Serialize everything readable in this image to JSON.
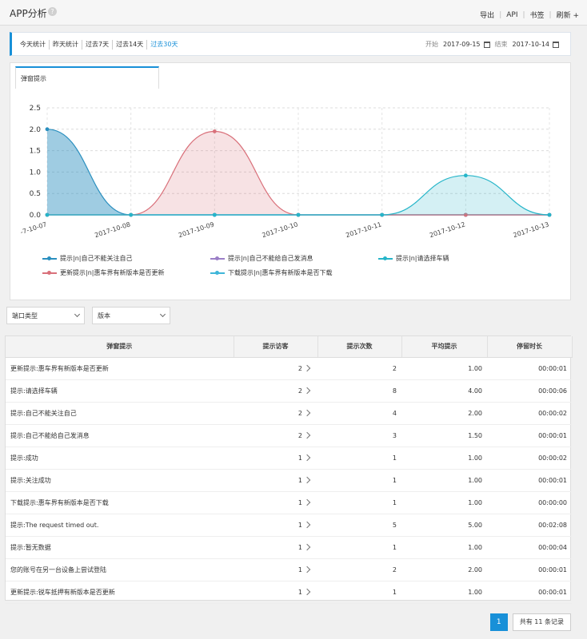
{
  "header": {
    "title": "APP分析",
    "help_icon": "help-icon",
    "actions": [
      "导出",
      "API",
      "书签",
      "刷新 +"
    ]
  },
  "period": {
    "tabs": [
      "今天统计",
      "昨天统计",
      "过去7天",
      "过去14天",
      "过去30天"
    ],
    "active": 4,
    "start_label": "开始",
    "start_value": "2017-09-15",
    "end_label": "结束",
    "end_value": "2017-10-14"
  },
  "chart": {
    "tab_label": "弹窗提示"
  },
  "chart_data": {
    "type": "area",
    "x": [
      "2017-10-07",
      "2017-10-08",
      "2017-10-09",
      "2017-10-10",
      "2017-10-11",
      "2017-10-12",
      "2017-10-13"
    ],
    "x_tick_labels": [
      "-7-10-07",
      "2017-10-08",
      "2017-10-09",
      "2017-10-10",
      "2017-10-11",
      "2017-10-12",
      "2017-10-13"
    ],
    "ylim": [
      0,
      2.5
    ],
    "y_ticks": [
      "0.0",
      "0.5",
      "1.0",
      "1.5",
      "2.0",
      "2.5"
    ],
    "grid": true,
    "legend_position": "bottom",
    "series": [
      {
        "name": "提示|n|自己不能关注自己",
        "color": "#2a8fbf",
        "values": [
          2,
          0,
          0,
          0,
          0,
          0,
          0
        ]
      },
      {
        "name": "提示|n|自己不能给自己发消息",
        "color": "#9b7fc7",
        "values": [
          0,
          0,
          0,
          0,
          0,
          0,
          0
        ]
      },
      {
        "name": "提示|n|请选择车辆",
        "color": "#26b5c9",
        "values": [
          0,
          0,
          0,
          0,
          0,
          0.92,
          0
        ]
      },
      {
        "name": "更新提示|n|惠车界有新版本是否更新",
        "color": "#d9707a",
        "values": [
          0,
          0,
          1.95,
          0,
          0,
          0,
          0
        ]
      },
      {
        "name": "下载提示|n|惠车界有新版本是否下载",
        "color": "#3fb6d9",
        "values": [
          0,
          0,
          0,
          0,
          0,
          0,
          0
        ]
      }
    ]
  },
  "filters": {
    "endpoint_label": "端口类型",
    "version_label": "版本"
  },
  "table": {
    "headers": [
      "弹窗提示",
      "提示访客",
      "提示次数",
      "平均提示",
      "停留时长"
    ],
    "rows": [
      {
        "name": "更新提示:惠车界有新版本是否更新",
        "visitors": "2",
        "count": "2",
        "avg": "1.00",
        "duration": "00:00:01"
      },
      {
        "name": "提示:请选择车辆",
        "visitors": "2",
        "count": "8",
        "avg": "4.00",
        "duration": "00:00:06"
      },
      {
        "name": "提示:自己不能关注自己",
        "visitors": "2",
        "count": "4",
        "avg": "2.00",
        "duration": "00:00:02"
      },
      {
        "name": "提示:自己不能给自己发消息",
        "visitors": "2",
        "count": "3",
        "avg": "1.50",
        "duration": "00:00:01"
      },
      {
        "name": "提示:成功",
        "visitors": "1",
        "count": "1",
        "avg": "1.00",
        "duration": "00:00:02"
      },
      {
        "name": "提示:关注成功",
        "visitors": "1",
        "count": "1",
        "avg": "1.00",
        "duration": "00:00:01"
      },
      {
        "name": "下载提示:惠车界有新版本是否下载",
        "visitors": "1",
        "count": "1",
        "avg": "1.00",
        "duration": "00:00:00"
      },
      {
        "name": "提示:The request timed out.",
        "visitors": "1",
        "count": "5",
        "avg": "5.00",
        "duration": "00:02:08"
      },
      {
        "name": "提示:暂无数据",
        "visitors": "1",
        "count": "1",
        "avg": "1.00",
        "duration": "00:00:04"
      },
      {
        "name": "您的账号在另一台设备上尝试登陆",
        "visitors": "1",
        "count": "2",
        "avg": "2.00",
        "duration": "00:00:01"
      },
      {
        "name": "更新提示:锐车抵押有新版本是否更新",
        "visitors": "1",
        "count": "1",
        "avg": "1.00",
        "duration": "00:00:01"
      }
    ]
  },
  "pager": {
    "current": "1",
    "total_text": "共有 11 条记录"
  }
}
